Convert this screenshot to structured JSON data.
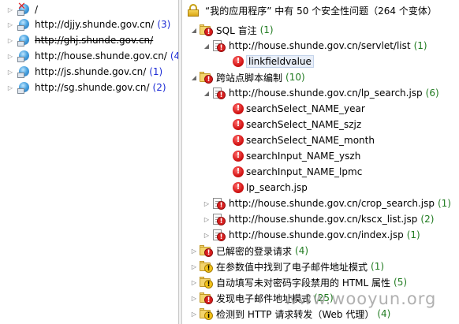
{
  "left_tree": {
    "hosts": [
      {
        "label": "/",
        "count": "",
        "struck": false,
        "marked": true
      },
      {
        "label": "http://djjy.shunde.gov.cn/",
        "count": "(3)",
        "struck": false,
        "marked": false
      },
      {
        "label": "http://ghj.shunde.gov.cn/",
        "count": "",
        "struck": true,
        "marked": false
      },
      {
        "label": "http://house.shunde.gov.cn/",
        "count": "(44",
        "struck": false,
        "marked": false
      },
      {
        "label": "http://js.shunde.gov.cn/",
        "count": "(1)",
        "struck": false,
        "marked": false
      },
      {
        "label": "http://sg.shunde.gov.cn/",
        "count": "(2)",
        "struck": false,
        "marked": false
      }
    ]
  },
  "right_tree": {
    "root": {
      "label": "“我的应用程序” 中有 50 个安全性问题（264 个变体）",
      "icon": "lock-icon"
    },
    "groups": {
      "sql": {
        "label": "SQL 盲注",
        "count": "(1)"
      },
      "sql_url": {
        "label": "http://house.shunde.gov.cn/servlet/list",
        "count": "(1)"
      },
      "sql_param": {
        "label": "linkfieldvalue"
      },
      "xss": {
        "label": "跨站点脚本编制",
        "count": "(10)"
      },
      "xss_url1": {
        "label": "http://house.shunde.gov.cn/lp_search.jsp",
        "count": "(6)"
      },
      "xss_params": [
        "searchSelect_NAME_year",
        "searchSelect_NAME_szjz",
        "searchSelect_NAME_month",
        "searchInput_NAME_yszh",
        "searchInput_NAME_lpmc",
        "lp_search.jsp"
      ],
      "xss_url2": {
        "label": "http://house.shunde.gov.cn/crop_search.jsp",
        "count": "(1)"
      },
      "xss_url3": {
        "label": "http://house.shunde.gov.cn/kscx_list.jsp",
        "count": "(2)"
      },
      "xss_url4": {
        "label": "http://house.shunde.gov.cn/index.jsp",
        "count": "(1)"
      },
      "login": {
        "label": "已解密的登录请求",
        "count": "(4)"
      },
      "email_param": {
        "label": "在参数值中找到了电子邮件地址模式",
        "count": "(1)"
      },
      "autocomplete": {
        "label": "自动填写未对密码字段禁用的 HTML 属性",
        "count": "(5)"
      },
      "email_found": {
        "label": "发现电子邮件地址模式",
        "count": "(25)"
      },
      "http_forward": {
        "label": "检测到 HTTP 请求转发（Web 代理）",
        "count": "(4)"
      }
    }
  },
  "watermark": "www.wooyun.org"
}
